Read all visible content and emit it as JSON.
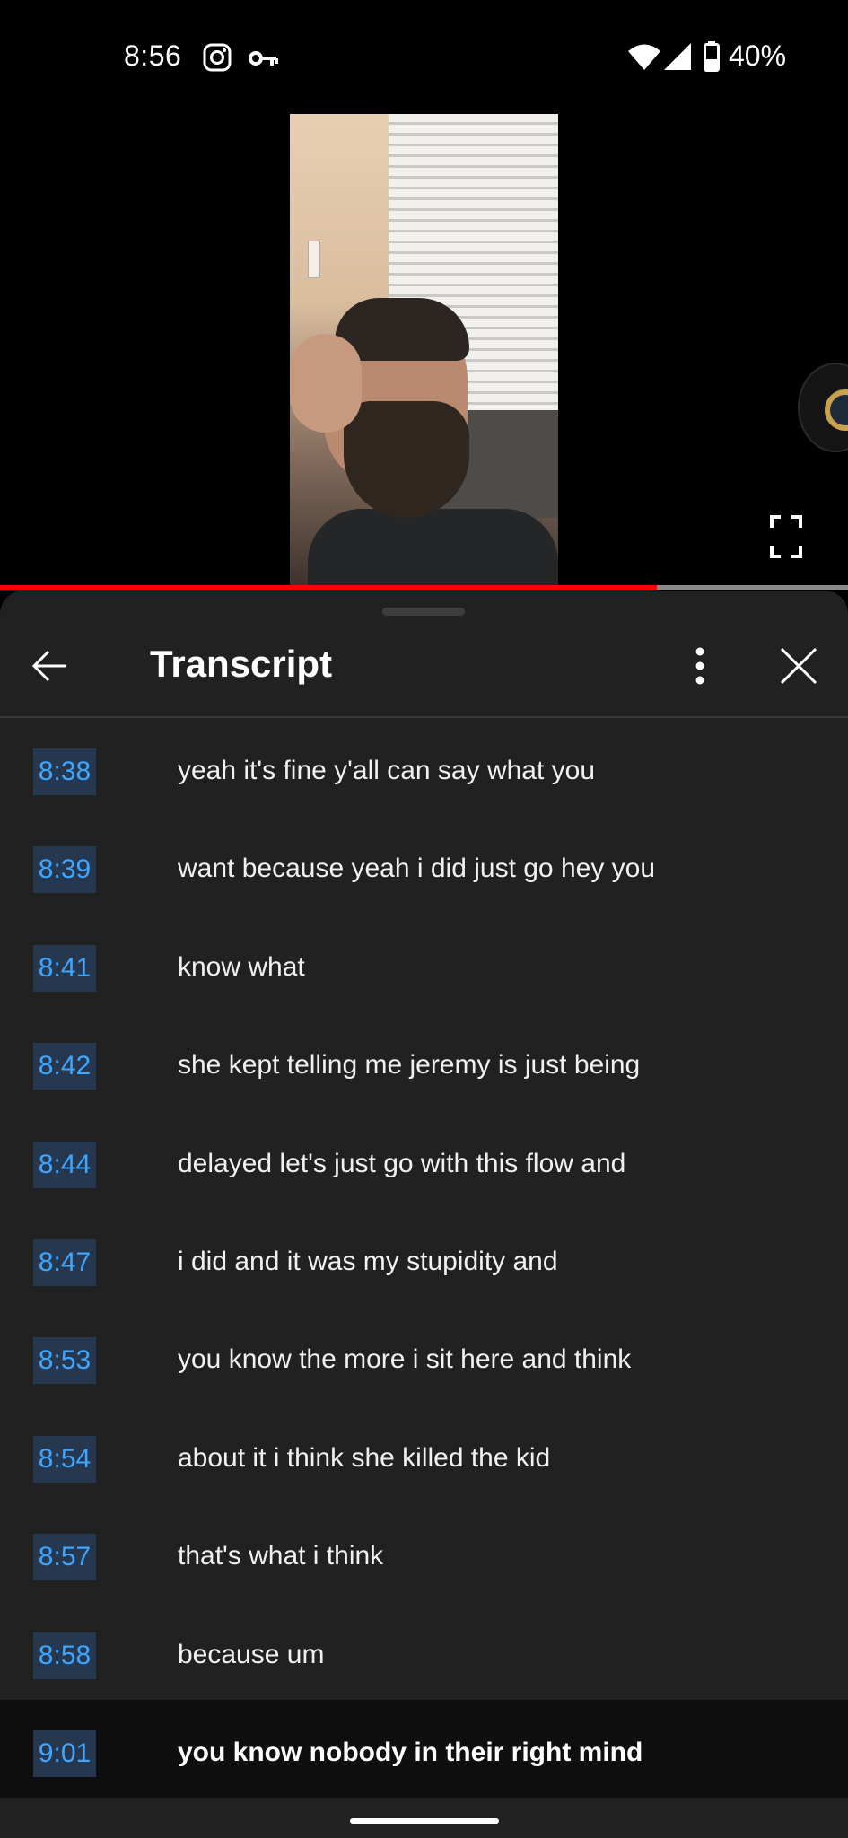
{
  "status_bar": {
    "time": "8:56",
    "battery": "40%",
    "icons": [
      "instagram-icon",
      "vpn-key-icon",
      "wifi-icon",
      "cell-signal-icon",
      "battery-icon"
    ]
  },
  "video": {
    "progress_fraction": 0.775,
    "progress_color": "#ff0000"
  },
  "transcript_panel": {
    "title": "Transcript",
    "accent_color": "#3ea6ff",
    "lines": [
      {
        "time": "8:38",
        "text": "yeah it's fine y'all can say what you"
      },
      {
        "time": "8:39",
        "text": "want because yeah i did just go hey you"
      },
      {
        "time": "8:41",
        "text": "know what"
      },
      {
        "time": "8:42",
        "text": "she kept telling me jeremy is just being"
      },
      {
        "time": "8:44",
        "text": "delayed let's just go with this flow and"
      },
      {
        "time": "8:47",
        "text": "i did and it was my stupidity and"
      },
      {
        "time": "8:53",
        "text": "you know the more i sit here and think"
      },
      {
        "time": "8:54",
        "text": "about it i think she killed the kid"
      },
      {
        "time": "8:57",
        "text": "that's what i think"
      },
      {
        "time": "8:58",
        "text": "because um"
      },
      {
        "time": "9:01",
        "text": "you know nobody in their right mind",
        "active": true
      }
    ]
  }
}
